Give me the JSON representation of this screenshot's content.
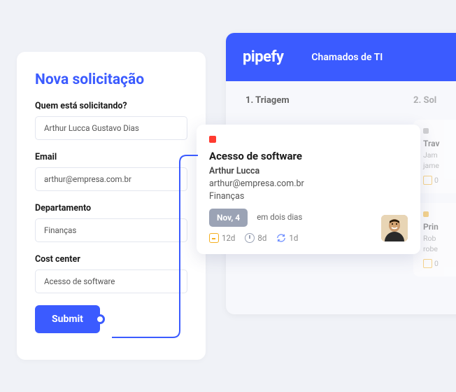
{
  "form": {
    "title": "Nova solicitação",
    "fields": {
      "requester_label": "Quem está solicitando?",
      "requester_value": "Arthur Lucca Gustavo Dias",
      "email_label": "Email",
      "email_value": "arthur@empresa.com.br",
      "department_label": "Departamento",
      "department_value": "Finanças",
      "costcenter_label": "Cost center",
      "costcenter_value": "Acesso de software"
    },
    "submit_label": "Submit"
  },
  "kanban": {
    "logo": "pipefy",
    "board_title": "Chamados de TI",
    "col1_title": "1. Triagem",
    "col2_title": "2. Sol"
  },
  "partial_card1": {
    "title": "Trav",
    "line1": "Jam",
    "line2": "jame",
    "meta": "0"
  },
  "partial_card2": {
    "title": "Prin",
    "line1": "Rob",
    "line2": "robe",
    "meta": "0"
  },
  "main_card": {
    "title": "Acesso de software",
    "name": "Arthur Lucca",
    "email": "arthur@empresa.com.br",
    "department": "Finanças",
    "date_badge": "Nov, 4",
    "date_text": "em dois dias",
    "meta1": "12d",
    "meta2": "8d",
    "meta3": "1d"
  }
}
